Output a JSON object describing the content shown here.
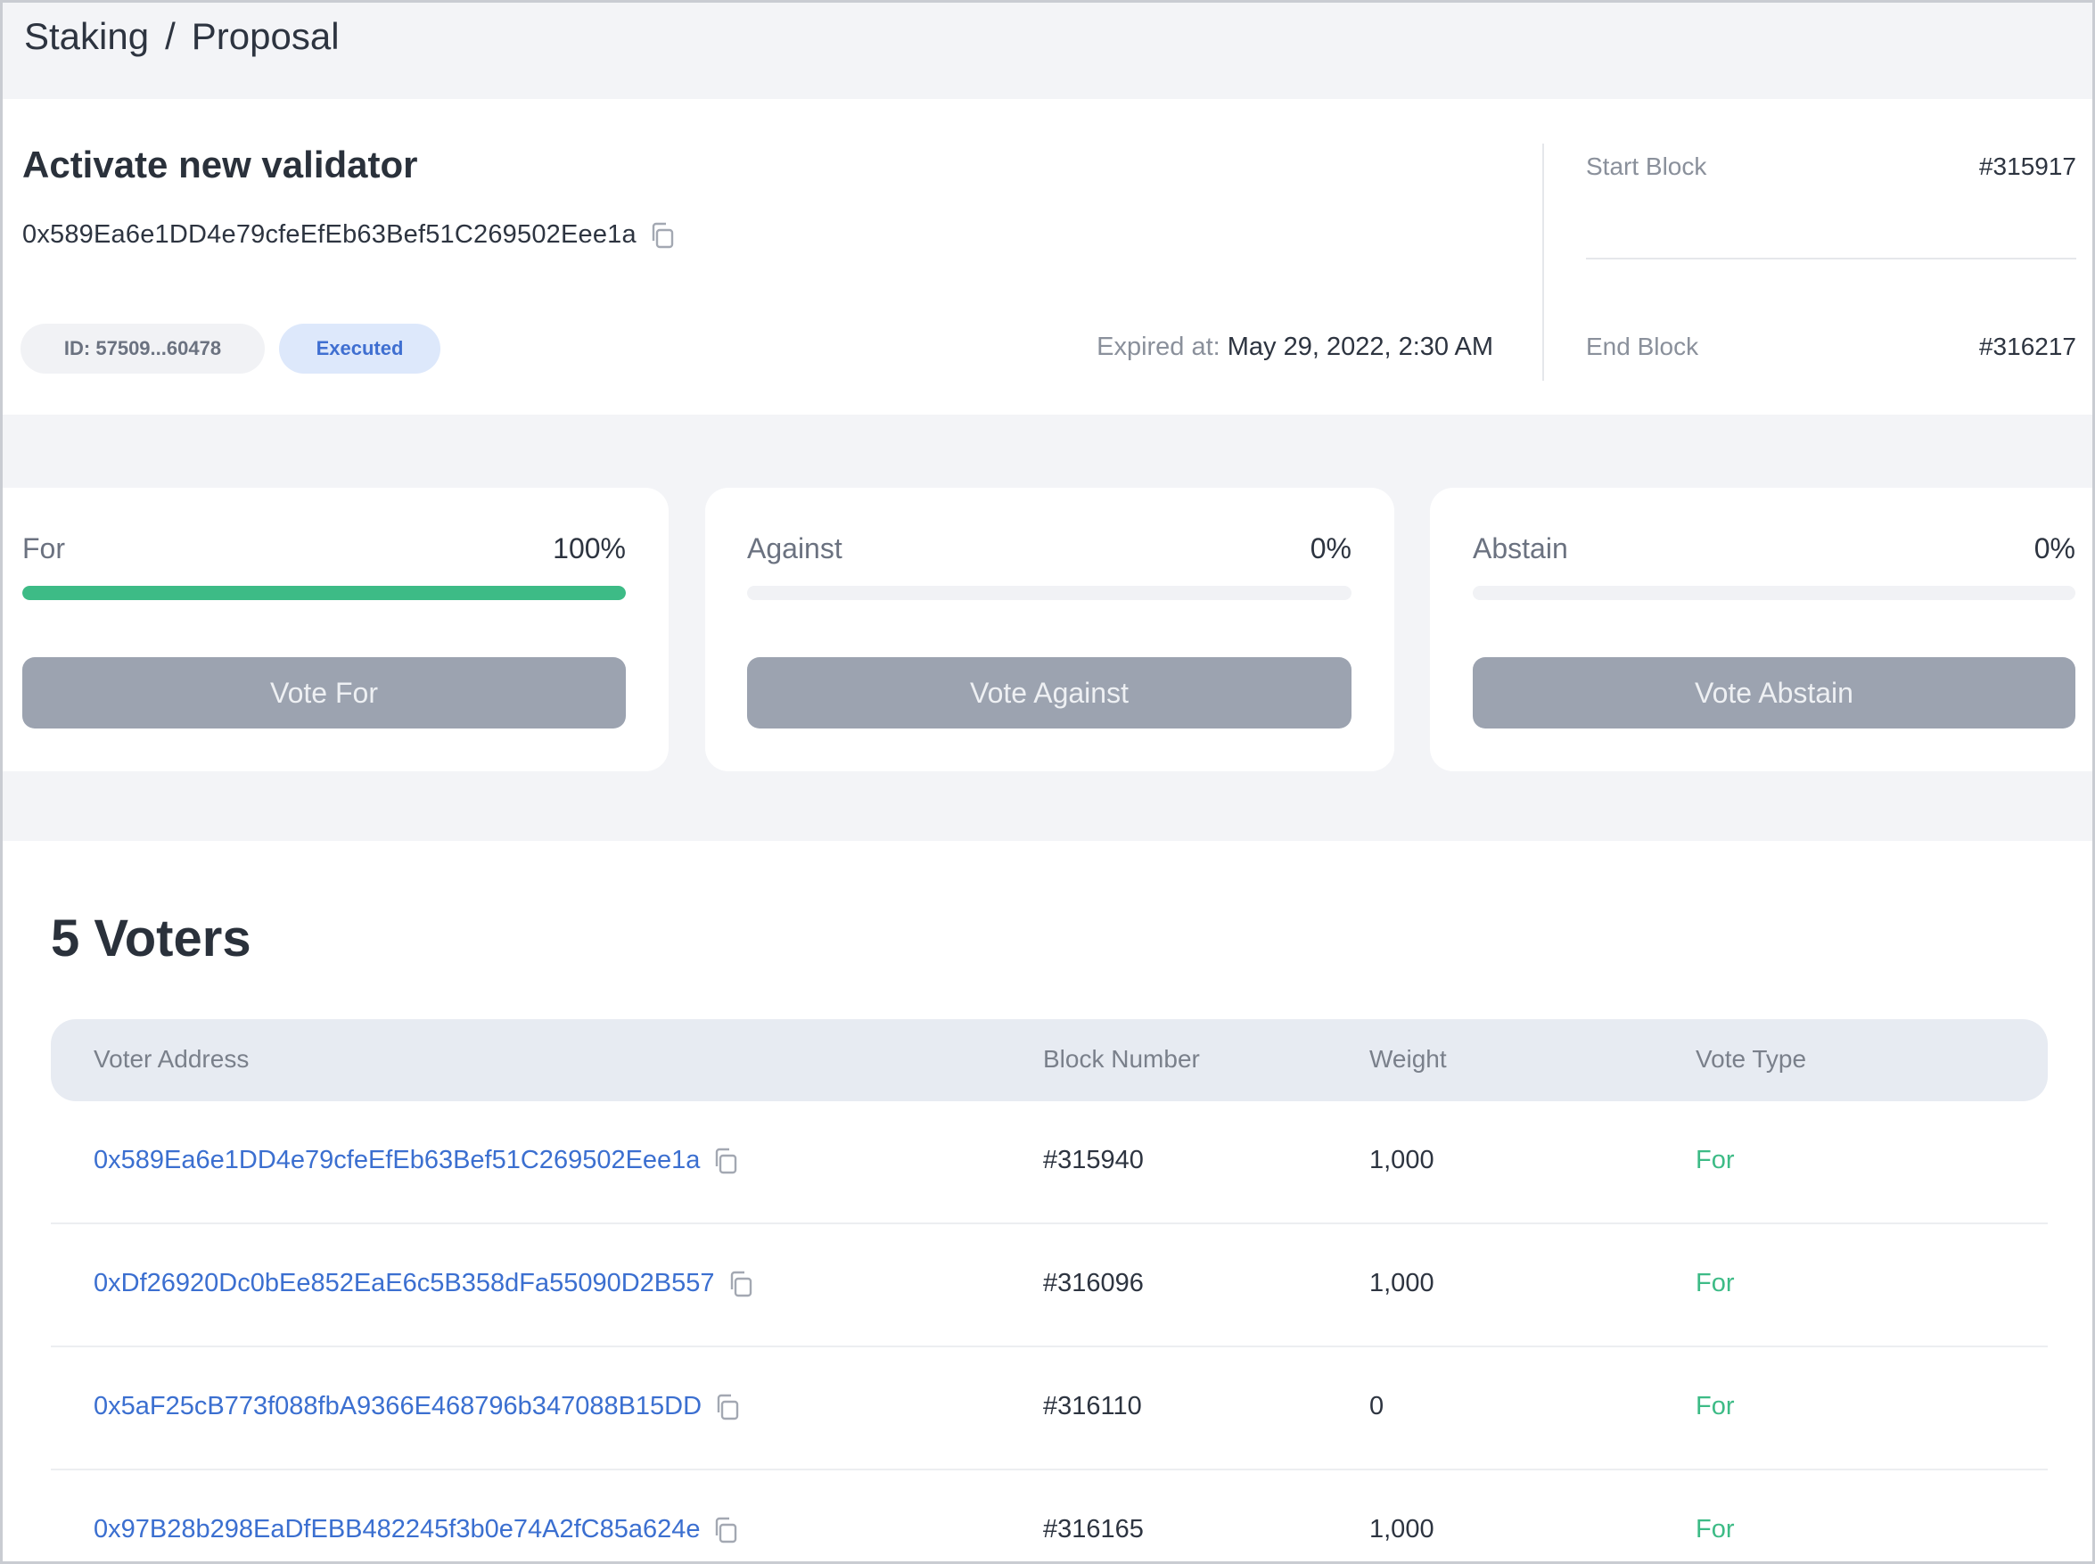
{
  "breadcrumb": {
    "section": "Staking",
    "separator": "/",
    "page": "Proposal"
  },
  "proposal": {
    "title": "Activate new validator",
    "address": "0x589Ea6e1DD4e79cfeEfEb63Bef51C269502Eee1a",
    "id_label": "ID: 57509...60478",
    "status": "Executed",
    "expired_label": "Expired at:",
    "expired_value": "May 29, 2022, 2:30 AM",
    "start_block_label": "Start Block",
    "start_block_value": "#315917",
    "end_block_label": "End Block",
    "end_block_value": "#316217"
  },
  "votes": [
    {
      "label": "For",
      "percent": "100%",
      "fill": 1.0,
      "button": "Vote For"
    },
    {
      "label": "Against",
      "percent": "0%",
      "fill": 0.0,
      "button": "Vote Against"
    },
    {
      "label": "Abstain",
      "percent": "0%",
      "fill": 0.0,
      "button": "Vote Abstain"
    }
  ],
  "voters": {
    "title": "5 Voters",
    "columns": [
      "Voter Address",
      "Block Number",
      "Weight",
      "Vote Type"
    ],
    "rows": [
      {
        "address": "0x589Ea6e1DD4e79cfeEfEb63Bef51C269502Eee1a",
        "block": "#315940",
        "weight": "1,000",
        "type": "For"
      },
      {
        "address": "0xDf26920Dc0bEe852EaE6c5B358dFa55090D2B557",
        "block": "#316096",
        "weight": "1,000",
        "type": "For"
      },
      {
        "address": "0x5aF25cB773f088fbA9366E468796b347088B15DD",
        "block": "#316110",
        "weight": "0",
        "type": "For"
      },
      {
        "address": "0x97B28b298EaDfEBB482245f3b0e74A2fC85a624e",
        "block": "#316165",
        "weight": "1,000",
        "type": "For"
      }
    ]
  },
  "colors": {
    "accent_green": "#3dbb86",
    "link_blue": "#3b6fd0",
    "button_gray": "#9ca3b0"
  },
  "icons": {
    "copy": "copy-icon"
  }
}
